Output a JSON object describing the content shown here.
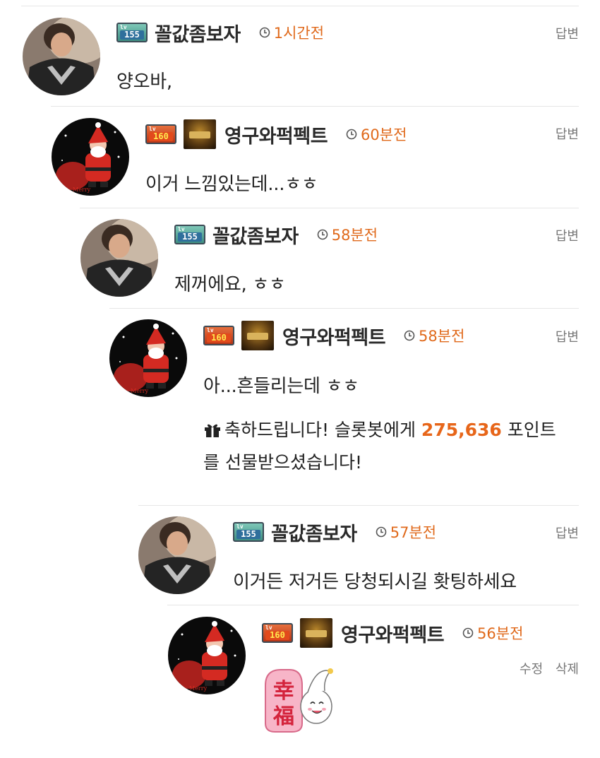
{
  "comments": [
    {
      "level": "155",
      "nickname": "꼴값좀보자",
      "time": "1시간전",
      "action": "답변",
      "text": "양오바,"
    },
    {
      "level": "160",
      "nickname": "영구와퍽펙트",
      "time": "60분전",
      "action": "답변",
      "text": "이거 느낌있는데...ㅎㅎ"
    },
    {
      "level": "155",
      "nickname": "꼴값좀보자",
      "time": "58분전",
      "action": "답변",
      "text": "제꺼에요, ㅎㅎ"
    },
    {
      "level": "160",
      "nickname": "영구와퍽펙트",
      "time": "58분전",
      "action": "답변",
      "text": "아...흔들리는데 ㅎㅎ",
      "gift": {
        "prefix": "축하드립니다! 슬롯봇에게 ",
        "amount": "275,636",
        "suffix": " 포인트를 선물받으셨습니다!"
      }
    },
    {
      "level": "155",
      "nickname": "꼴값좀보자",
      "time": "57분전",
      "action": "답변",
      "text": "이거든 저거든 당청되시길 홧팅하세요"
    },
    {
      "level": "160",
      "nickname": "영구와퍽펙트",
      "time": "56분전",
      "edit": "수정",
      "delete": "삭제",
      "sticker": {
        "char1": "幸",
        "char2": "福"
      }
    }
  ],
  "colors": {
    "accent": "#e06a1c",
    "amount": "#e7661a",
    "separator": "#e6e6e6"
  },
  "icons": {
    "clock": "clock-icon",
    "gift": "gift-icon",
    "man_avatar": "man-avatar",
    "santa_avatar": "santa-avatar"
  }
}
